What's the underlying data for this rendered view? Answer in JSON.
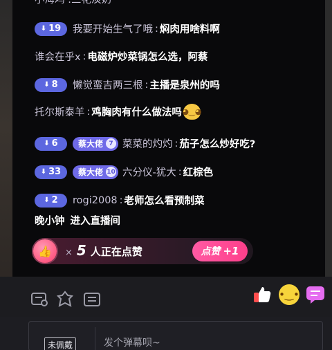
{
  "chat": {
    "cutoff_text": "小海鸡 :三花淡奶",
    "messages": [
      {
        "level": "19",
        "user": "我要开始生气了哦",
        "text": "焖肉用啥料啊"
      },
      {
        "user": "谁会在乎x",
        "text": "电磁炉炒菜锅怎么选，阿蔡"
      },
      {
        "level": "8",
        "user": "懒觉蛮吉两三根",
        "text": "主播是泉州的吗"
      },
      {
        "user": "托尔斯泰羊",
        "text": "鸡胸肉有什么做法吗",
        "emoji": "cat-emoji"
      },
      {
        "level": "6",
        "fan_badge": "蔡大佬",
        "fan_level": "7",
        "user": "菜菜的灼灼",
        "text": "茄子怎么炒好吃?"
      },
      {
        "level": "33",
        "fan_badge": "蔡大佬",
        "fan_level": "10",
        "user": "六分仪-犹大",
        "text": "红棕色"
      },
      {
        "level": "2",
        "user": "rogi2008",
        "text": "老师怎么看预制菜"
      }
    ],
    "enter_notice": {
      "user": "晚小钟",
      "action": "进入直播间"
    }
  },
  "like_bar": {
    "multiplier": "×",
    "count": "5",
    "label": "人正在点赞",
    "button_label": "点赞",
    "button_plus": "+1"
  },
  "toolbar": {
    "icons": [
      "danmaku-settings-icon",
      "gift-icon",
      "list-icon"
    ],
    "reactions": [
      "thumbs-up-icon",
      "emoji-face-icon",
      "chat-bubble-icon"
    ]
  },
  "input": {
    "medal_label": "未佩戴",
    "placeholder": "发个弹幕呗~"
  },
  "colors": {
    "level_badge": "#5c67e0",
    "fan_badge": "#6f6ae8",
    "like_button": "#ff4f97",
    "panel_bg": "#08080a"
  }
}
